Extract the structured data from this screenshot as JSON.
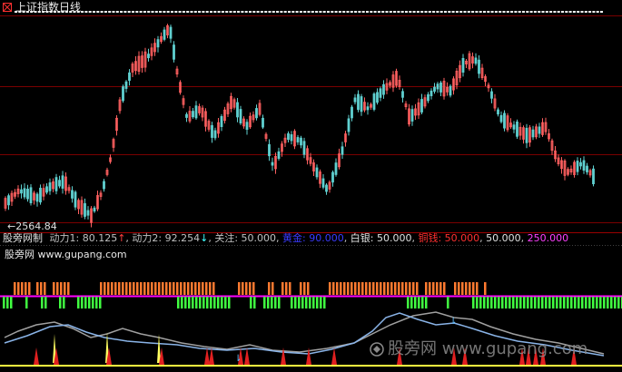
{
  "window": {
    "title": "上证指数日线"
  },
  "price_panel": {
    "low_label": "←2564.84"
  },
  "indicator_legend": {
    "name": "股旁网制",
    "dongli1_label": "动力1: ",
    "dongli1_value": "80.125",
    "dongli1_arrow": "↑",
    "dongli2_label": "动力2: ",
    "dongli2_value": "92.254",
    "dongli2_arrow": "↓",
    "guanzhu": "关注: 50.000",
    "huangjin": "黄金: 90.000",
    "baiyin": "白银: 50.000",
    "tongqian": "铜钱: 50.000",
    "v5": "50.000",
    "v6": "250.000",
    "sep": ", ",
    "colors": {
      "name": "#e0e0e0",
      "dongli1": "#c0c0c0",
      "arrow_up": "#ff4040",
      "dongli2": "#c0c0c0",
      "arrow_down": "#40ffff",
      "guanzhu": "#c0c0c0",
      "huangjin": "#3a3aff",
      "baiyin": "#e0e0e0",
      "tongqian": "#ff3030",
      "v5": "#e0e0e0",
      "v6": "#ff40ff"
    }
  },
  "lower_panel": {
    "site_label": "股旁网 www.gupang.com"
  },
  "watermark": {
    "text": "股旁网 www.gupang.com"
  },
  "colors": {
    "up_candle": "#ff6060",
    "down_candle": "#5fd0d0",
    "grid_red": "#7a0000",
    "orange_bar": "#ff7a30",
    "green_bar": "#40ff40",
    "magenta_line": "#ff00ff",
    "gray_line": "#a0a0a0",
    "blue_line": "#8ab4e8",
    "yellow_spike": "#ffff60",
    "red_spike": "#e02020",
    "white_marks": "#ffffff"
  }
}
